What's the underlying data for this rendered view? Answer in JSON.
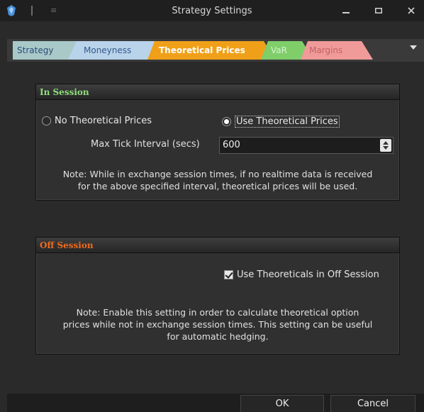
{
  "window": {
    "title": "Strategy Settings",
    "minimize_icon": "minimize-icon",
    "maximize_icon": "maximize-icon",
    "close_icon": "close-icon"
  },
  "tabs": [
    {
      "label": "Strategy",
      "color": "#a9c9c9",
      "active": false
    },
    {
      "label": "Moneyness",
      "color": "#b9d3eb",
      "active": false
    },
    {
      "label": "Theoretical Prices",
      "color": "#f0a018",
      "active": true
    },
    {
      "label": "VaR",
      "color": "#7fce6a",
      "active": false
    },
    {
      "label": "Margins",
      "color": "#f09a9a",
      "active": false
    }
  ],
  "in_session": {
    "header": "In Session",
    "radio_none_label": "No Theoretical Prices",
    "radio_use_label": "Use Theoretical Prices",
    "selected": "Use Theoretical Prices",
    "tick_label": "Max Tick Interval (secs)",
    "tick_value": "600",
    "note_line1": "Note: While in exchange session times, if no realtime data is received",
    "note_line2": "for the above specified interval, theoretical prices will be used."
  },
  "off_session": {
    "header": "Off Session",
    "checkbox_label": "Use Theoreticals in Off Session",
    "checkbox_checked": true,
    "note_line1": "Note: Enable this setting in order to calculate theoretical option",
    "note_line2": "prices while not in exchange session times. This setting can be useful",
    "note_line3": "for automatic hedging."
  },
  "footer": {
    "ok_label": "OK",
    "cancel_label": "Cancel"
  },
  "colors": {
    "in_session_header": "#8fe07a",
    "off_session_header": "#f26a1b",
    "active_tab": "#f0a018"
  }
}
